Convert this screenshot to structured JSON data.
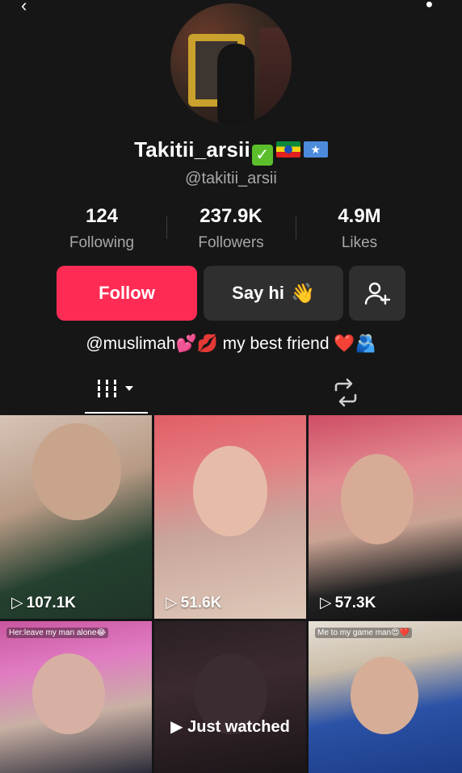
{
  "header": {
    "back_icon": "chevron-left-icon",
    "more_icon": "dot-icon"
  },
  "profile": {
    "display_name": "Takitii_arsii",
    "verified_emoji": "✅",
    "flags": [
      "ethiopia-flag",
      "somalia-flag"
    ],
    "handle": "@takitii_arsii"
  },
  "stats": {
    "following": {
      "value": "124",
      "label": "Following"
    },
    "followers": {
      "value": "237.9K",
      "label": "Followers"
    },
    "likes": {
      "value": "4.9M",
      "label": "Likes"
    }
  },
  "actions": {
    "follow_label": "Follow",
    "sayhi_label": "Say hi",
    "sayhi_emoji": "👋",
    "add_friend_icon": "add-user-icon"
  },
  "bio": {
    "text": "@muslimah💕💋 my best friend ❤️🫂"
  },
  "tabs": {
    "videos_icon": "grid-icon",
    "reposts_icon": "repost-icon"
  },
  "videos": [
    {
      "views": "107.1K",
      "caption": ""
    },
    {
      "views": "51.6K",
      "caption": ""
    },
    {
      "views": "57.3K",
      "caption": ""
    },
    {
      "views": "",
      "caption": "Her:leave my man alone😂"
    },
    {
      "views": "",
      "caption": "",
      "overlay": "Just watched"
    },
    {
      "views": "",
      "caption": "Me to my game man😍❤️"
    }
  ],
  "colors": {
    "background": "#161616",
    "follow_button": "#fe2c55",
    "secondary_button": "#2f2f2f",
    "muted_text": "#a7a7a7"
  }
}
